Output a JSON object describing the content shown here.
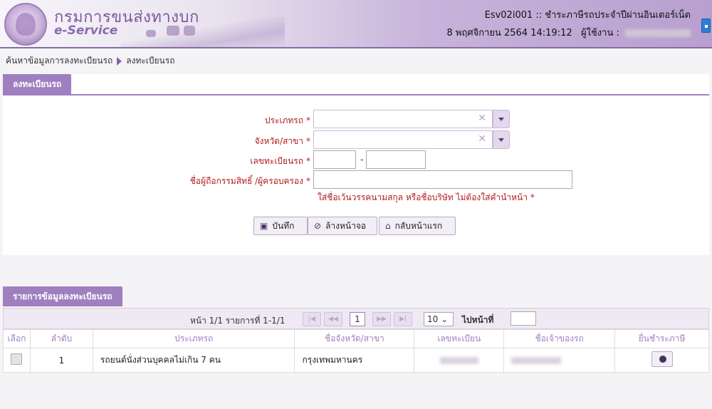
{
  "header": {
    "brand_th": "กรมการขนส่งทางบก",
    "brand_en": "e-Service",
    "page_code": "Esv02i001 :: ชำระภาษีรถประจำปีผ่านอินเตอร์เน็ต",
    "datetime": "8 พฤศจิกายน 2564 14:19:12",
    "user_label": "ผู้ใช้งาน :"
  },
  "breadcrumb": {
    "item1": "ค้นหาข้อมูลการลงทะเบียนรถ",
    "item2": "ลงทะเบียนรถ"
  },
  "form": {
    "title": "ลงทะเบียนรถ",
    "vehicle_type_label": "ประเภทรถ",
    "province_label": "จังหวัด/สาขา",
    "plate_label": "เลขทะเบียนรถ",
    "owner_label": "ชื่อผู้ถือกรรมสิทธิ์ /ผู้ครอบครอง",
    "required": "*",
    "clear_glyph": "✕",
    "plate_dash": "-",
    "owner_note": "ใส่ชื่อเว้นวรรคนามสกุล หรือชื่อบริษัท ไม่ต้องใส่คำนำหน้า *",
    "save": "บันทึก",
    "reset": "ล้างหน้าจอ",
    "home": "กลับหน้าแรก"
  },
  "list": {
    "title": "รายการข้อมูลลงทะเบียนรถ",
    "pager_text": "หน้า 1/1 รายการที่ 1-1/1",
    "current_page": "1",
    "page_size": "10",
    "goto_label": "ไปหน้าที่",
    "columns": {
      "select": "เลือก",
      "order": "ลำดับ",
      "type": "ประเภทรถ",
      "province": "ชื่อจังหวัด/สาขา",
      "plate": "เลขทะเบียน",
      "owner": "ชื่อเจ้าของรถ",
      "pay": "ยื่นชำระภาษี"
    },
    "rows": [
      {
        "order": "1",
        "type": "รถยนต์นั่งส่วนบุคคลไม่เกิน 7 คน",
        "province": "กรุงเทพมหานคร"
      }
    ]
  },
  "colors": {
    "accent": "#a07fc0",
    "required": "#b11c1c",
    "brand": "#7d5b9d"
  }
}
